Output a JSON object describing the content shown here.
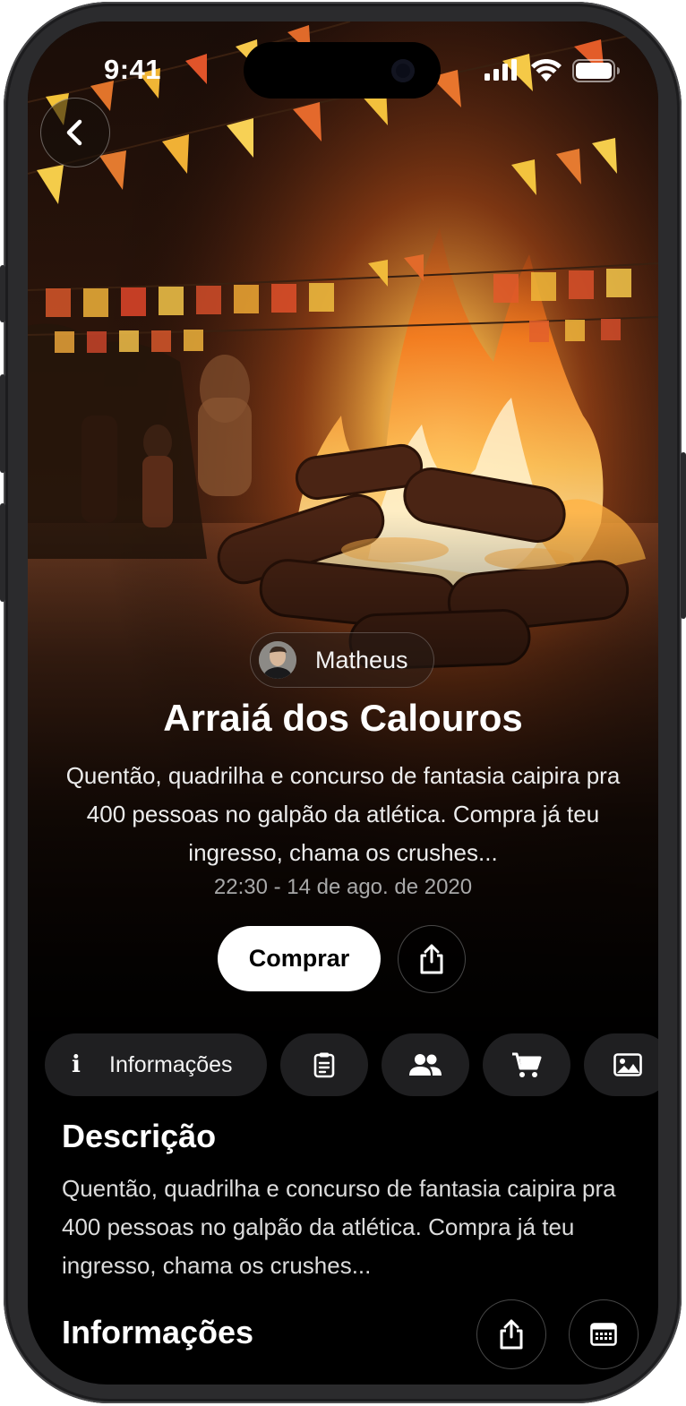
{
  "status_bar": {
    "time": "9:41"
  },
  "host": {
    "name": "Matheus"
  },
  "event": {
    "title": "Arraiá dos Calouros",
    "description": "Quentão, quadrilha e concurso de fantasia caipira pra 400 pessoas no galpão da atlética. Compra já teu ingresso, chama os crushes...",
    "datetime": "22:30 - 14 de ago. de 2020"
  },
  "actions": {
    "buy_label": "Comprar"
  },
  "tabs": [
    {
      "label": "Informações",
      "icon": "info-icon",
      "selected": true
    },
    {
      "icon": "clipboard-icon"
    },
    {
      "icon": "people-icon"
    },
    {
      "icon": "cart-icon"
    },
    {
      "icon": "image-icon"
    }
  ],
  "sections": {
    "description": {
      "title": "Descrição",
      "body": "Quentão, quadrilha e concurso de fantasia caipira pra 400 pessoas no galpão da atlética. Compra já teu ingresso, chama os crushes..."
    },
    "info": {
      "title": "Informações"
    }
  },
  "colors": {
    "background": "#000000",
    "chip": "#1f1f21",
    "primary_button": "#ffffff",
    "text_primary": "#ffffff",
    "text_secondary": "#a8a8a8"
  }
}
